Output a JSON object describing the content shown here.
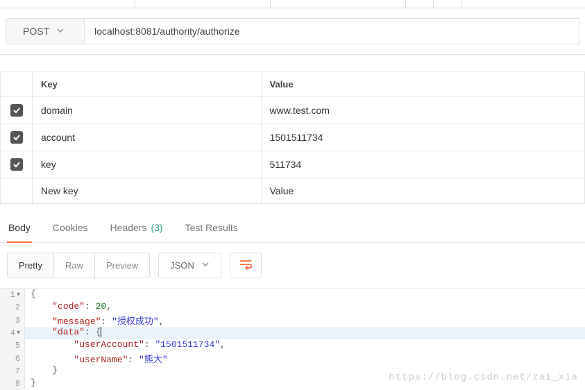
{
  "request": {
    "method": "POST",
    "url": "localhost:8081/authority/authorize"
  },
  "paramsHeaders": {
    "key": "Key",
    "value": "Value"
  },
  "params": [
    {
      "checked": true,
      "key": "domain",
      "value": "www.test.com"
    },
    {
      "checked": true,
      "key": "account",
      "value": "1501511734"
    },
    {
      "checked": true,
      "key": "key",
      "value": "511734"
    }
  ],
  "newRow": {
    "keyPH": "New key",
    "valuePH": "Value"
  },
  "responseTabs": {
    "body": "Body",
    "cookies": "Cookies",
    "headers": "Headers",
    "headersCount": "(3)",
    "testResults": "Test Results"
  },
  "bodyToolbar": {
    "pretty": "Pretty",
    "raw": "Raw",
    "preview": "Preview",
    "format": "JSON"
  },
  "responseLines": [
    {
      "n": "1",
      "fold": true,
      "indent": 0,
      "parts": [
        {
          "t": "{",
          "c": "brace"
        }
      ]
    },
    {
      "n": "2",
      "indent": 2,
      "parts": [
        {
          "t": "\"code\"",
          "c": "str-key"
        },
        {
          "t": ": ",
          "c": "punct"
        },
        {
          "t": "20",
          "c": "val-num"
        },
        {
          "t": ",",
          "c": "punct"
        }
      ]
    },
    {
      "n": "3",
      "indent": 2,
      "parts": [
        {
          "t": "\"message\"",
          "c": "str-key"
        },
        {
          "t": ": ",
          "c": "punct"
        },
        {
          "t": "\"授权成功\"",
          "c": "val-str"
        },
        {
          "t": ",",
          "c": "punct"
        }
      ]
    },
    {
      "n": "4",
      "fold": true,
      "hl": true,
      "indent": 2,
      "parts": [
        {
          "t": "\"data\"",
          "c": "str-key"
        },
        {
          "t": ": ",
          "c": "punct"
        },
        {
          "t": "{",
          "c": "brace"
        },
        {
          "t": "",
          "c": "cursor"
        }
      ]
    },
    {
      "n": "5",
      "indent": 4,
      "parts": [
        {
          "t": "\"userAccount\"",
          "c": "str-key"
        },
        {
          "t": ": ",
          "c": "punct"
        },
        {
          "t": "\"1501511734\"",
          "c": "val-str"
        },
        {
          "t": ",",
          "c": "punct"
        }
      ]
    },
    {
      "n": "6",
      "indent": 4,
      "parts": [
        {
          "t": "\"userName\"",
          "c": "str-key"
        },
        {
          "t": ": ",
          "c": "punct"
        },
        {
          "t": "\"熊大\"",
          "c": "val-str"
        }
      ]
    },
    {
      "n": "7",
      "indent": 2,
      "parts": [
        {
          "t": "}",
          "c": "brace"
        }
      ]
    },
    {
      "n": "8",
      "indent": 0,
      "parts": [
        {
          "t": "}",
          "c": "brace"
        }
      ]
    }
  ],
  "watermark": "https://blog.csdn.net/zai_xia"
}
